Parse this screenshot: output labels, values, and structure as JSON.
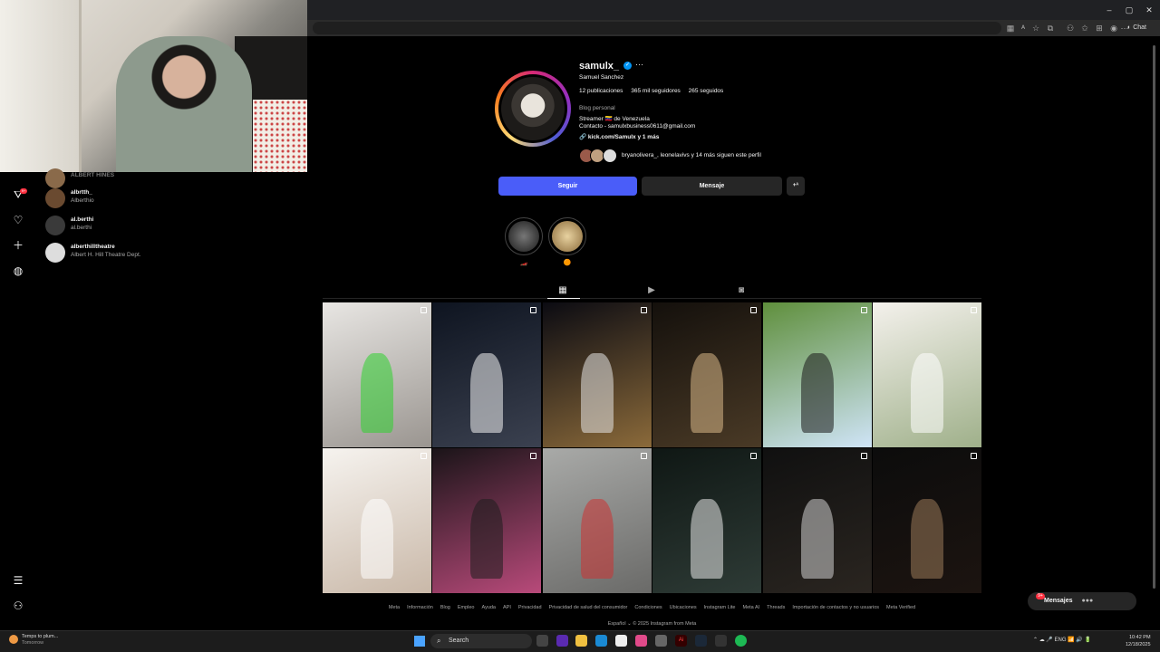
{
  "window": {
    "minimize": "–",
    "maximize": "▢",
    "close": "✕"
  },
  "toolbar": {
    "chat_label": "Chat"
  },
  "search_results": [
    {
      "username": "ALBERT HINES",
      "name": ""
    },
    {
      "username": "albrtth_",
      "name": "Alberthio"
    },
    {
      "username": "al.berthi",
      "name": "al.berthi"
    },
    {
      "username": "alberthilltheatre",
      "name": "Albert H. Hill Theatre Dept."
    }
  ],
  "sidebar": {
    "notif_badge": "9+"
  },
  "profile": {
    "username": "samulx_",
    "more": "···",
    "full_name": "Samuel Sanchez",
    "stats": {
      "posts": "12 publicaciones",
      "followers": "365 mil seguidores",
      "following": "265 seguidos"
    },
    "category": "Blog personal",
    "bio_line1": "Streamer 🇻🇪 de Venezuela",
    "bio_line2": "Contacto - samulxbusiness0611@gmail.com",
    "link": "🔗 kick.com/Samulx y 1 más",
    "followed_by": "bryanolivera_, leonelavivs y 14 más siguen este perfil"
  },
  "buttons": {
    "follow": "Seguir",
    "message": "Mensaje",
    "add": "+ᴬ"
  },
  "highlights": [
    {
      "label": "🏎️",
      "color": "#3a3a3a"
    },
    {
      "label": "🟠",
      "color": "#c49a5a"
    }
  ],
  "tabs": {
    "posts_icon": "▦",
    "reels_icon": "▶",
    "tagged_icon": "◙"
  },
  "posts": [
    {
      "color1": "#e8e6e3",
      "color2": "#9a9590",
      "accent": "#2fd12f"
    },
    {
      "color1": "#0e1420",
      "color2": "#3b4150",
      "accent": "#f2f2f2"
    },
    {
      "color1": "#0b0b12",
      "color2": "#8b6a3a",
      "accent": "#e5e5e5"
    },
    {
      "color1": "#14100c",
      "color2": "#4a3a26",
      "accent": "#d8b888"
    },
    {
      "color1": "#5f8f3c",
      "color2": "#cfe4f7",
      "accent": "#1a1a1a"
    },
    {
      "color1": "#f4f1ec",
      "color2": "#9fb08a",
      "accent": "#ffffff"
    },
    {
      "color1": "#f6f3ef",
      "color2": "#c9b8a8",
      "accent": "#ffffff"
    },
    {
      "color1": "#1a1418",
      "color2": "#b84a7a",
      "accent": "#1e1e1e"
    },
    {
      "color1": "#a9aaa8",
      "color2": "#6a6a68",
      "accent": "#c33"
    },
    {
      "color1": "#0f1714",
      "color2": "#2e3b36",
      "accent": "#e8e8e8"
    },
    {
      "color1": "#101010",
      "color2": "#2a2520",
      "accent": "#cfcfcf"
    },
    {
      "color1": "#0c0c0c",
      "color2": "#1c1410",
      "accent": "#9a7a5a"
    }
  ],
  "footer": {
    "links": [
      "Meta",
      "Información",
      "Blog",
      "Empleo",
      "Ayuda",
      "API",
      "Privacidad",
      "Privacidad de salud del consumidor",
      "Condiciones",
      "Ubicaciones",
      "Instagram Lite",
      "Meta AI",
      "Threads",
      "Importación de contactos y no usuarios",
      "Meta Verified"
    ],
    "bottom": "Español ⌄    © 2025 Instagram from Meta"
  },
  "messages_pill": {
    "label": "Mensajes",
    "badge": "9+"
  },
  "taskbar": {
    "weather_line1": "Temps to plum...",
    "weather_line2": "Tomorrow",
    "search": "Search",
    "tray": "⌃  ☁  🎤  ENG  📶  🔊  🔋",
    "time": "10:42 PM",
    "date": "12/18/2025"
  },
  "colors": {
    "follow_blue": "#4a5df9",
    "verified_blue": "#0095f6",
    "badge_red": "#ff3040"
  }
}
